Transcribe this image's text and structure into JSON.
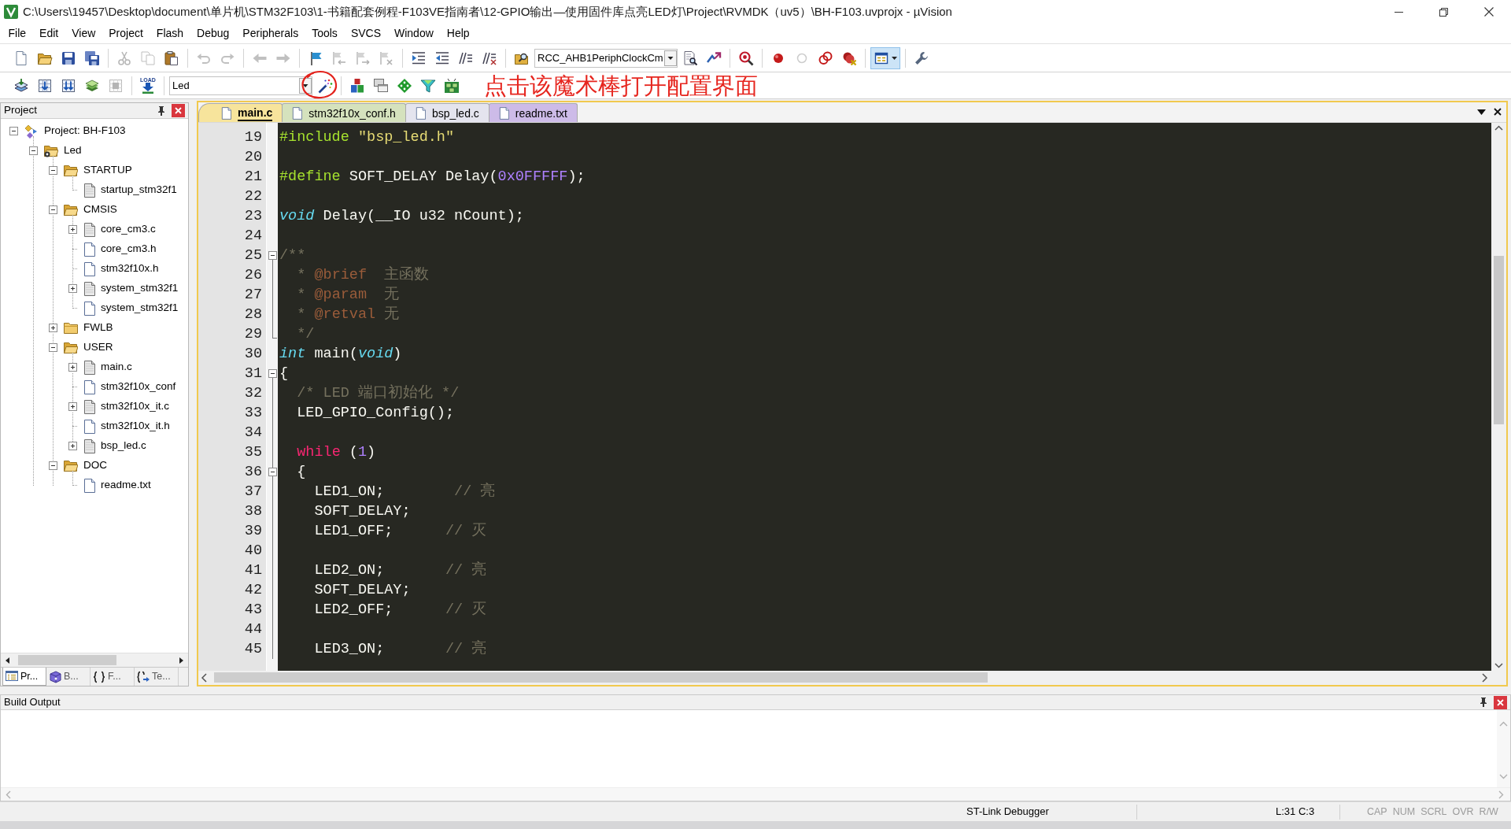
{
  "window": {
    "title": "C:\\Users\\19457\\Desktop\\document\\单片机\\STM32F103\\1-书籍配套例程-F103VE指南者\\12-GPIO输出—使用固件库点亮LED灯\\Project\\RVMDK（uv5）\\BH-F103.uvprojx - µVision",
    "menu": [
      "File",
      "Edit",
      "View",
      "Project",
      "Flash",
      "Debug",
      "Peripherals",
      "Tools",
      "SVCS",
      "Window",
      "Help"
    ]
  },
  "toolbars": [
    {
      "groups": [
        [
          {
            "kind": "new",
            "disabled": false,
            "pressed": false
          },
          {
            "kind": "open",
            "disabled": false,
            "pressed": false
          },
          {
            "kind": "save",
            "disabled": false,
            "pressed": false
          },
          {
            "kind": "save-all",
            "disabled": false,
            "pressed": false
          }
        ],
        [
          {
            "kind": "cut",
            "disabled": true,
            "pressed": false
          },
          {
            "kind": "copy",
            "disabled": true,
            "pressed": false
          },
          {
            "kind": "paste",
            "disabled": false,
            "pressed": false
          }
        ],
        [
          {
            "kind": "undo",
            "disabled": true,
            "pressed": false
          },
          {
            "kind": "redo",
            "disabled": true,
            "pressed": false
          }
        ],
        [
          {
            "kind": "back",
            "disabled": true,
            "pressed": false
          },
          {
            "kind": "forward",
            "disabled": true,
            "pressed": false
          }
        ],
        [
          {
            "kind": "bookmark",
            "disabled": false,
            "pressed": false
          },
          {
            "kind": "bookmark-prev",
            "disabled": true,
            "pressed": false
          },
          {
            "kind": "bookmark-next",
            "disabled": true,
            "pressed": false
          },
          {
            "kind": "bookmark-clear",
            "disabled": true,
            "pressed": false
          }
        ],
        [
          {
            "kind": "indent",
            "disabled": false,
            "pressed": false
          },
          {
            "kind": "outdent",
            "disabled": false,
            "pressed": false
          },
          {
            "kind": "comment",
            "disabled": false,
            "pressed": false
          },
          {
            "kind": "uncomment",
            "disabled": false,
            "pressed": false
          }
        ],
        [
          {
            "kind": "find-in-files",
            "disabled": false,
            "pressed": false
          },
          {
            "kind": "combo",
            "value": "RCC_AHB1PeriphClockCm"
          },
          {
            "kind": "find",
            "disabled": false,
            "pressed": false
          },
          {
            "kind": "incremental-find",
            "disabled": false,
            "pressed": false
          }
        ],
        [
          {
            "kind": "debug",
            "disabled": false,
            "pressed": false
          }
        ],
        [
          {
            "kind": "breakpoint",
            "disabled": false,
            "pressed": false
          },
          {
            "kind": "breakpoint-enable",
            "disabled": true,
            "pressed": false
          },
          {
            "kind": "breakpoint-disable-all",
            "disabled": false,
            "pressed": false
          },
          {
            "kind": "breakpoint-kill-all",
            "disabled": false,
            "pressed": false
          }
        ],
        [
          {
            "kind": "windows",
            "disabled": false,
            "pressed": true
          }
        ],
        [
          {
            "kind": "configure",
            "disabled": false,
            "pressed": false
          }
        ]
      ]
    },
    {
      "groups": [
        [
          {
            "kind": "translate",
            "disabled": false,
            "pressed": false
          },
          {
            "kind": "build",
            "disabled": false,
            "pressed": false
          },
          {
            "kind": "rebuild",
            "disabled": false,
            "pressed": false
          },
          {
            "kind": "batch-build",
            "disabled": false,
            "pressed": false
          },
          {
            "kind": "stop-build",
            "disabled": true,
            "pressed": false
          }
        ],
        [
          {
            "kind": "download",
            "label": "LOAD",
            "disabled": false,
            "pressed": false
          }
        ],
        [
          {
            "kind": "combo",
            "value": "Led"
          },
          {
            "kind": "options",
            "disabled": false,
            "pressed": false
          }
        ],
        [
          {
            "kind": "manage-project",
            "disabled": false,
            "pressed": false
          },
          {
            "kind": "multi-project",
            "disabled": false,
            "pressed": false
          },
          {
            "kind": "run-time-env",
            "disabled": false,
            "pressed": false
          },
          {
            "kind": "pack-select",
            "disabled": false,
            "pressed": false
          },
          {
            "kind": "pack-installer",
            "disabled": false,
            "pressed": false
          }
        ]
      ]
    }
  ],
  "annotation": {
    "text": "点击该魔术棒打开配置界面"
  },
  "project_panel": {
    "title": "Project",
    "tree": [
      {
        "label": "Project: BH-F103",
        "kind": "project",
        "expanded": true,
        "children": [
          {
            "label": "Led",
            "kind": "target",
            "expanded": true,
            "children": [
              {
                "label": "STARTUP",
                "kind": "group",
                "expanded": true,
                "children": [
                  {
                    "label": "startup_stm32f1",
                    "kind": "source"
                  }
                ]
              },
              {
                "label": "CMSIS",
                "kind": "group",
                "expanded": true,
                "children": [
                  {
                    "label": "core_cm3.c",
                    "kind": "source",
                    "expanded": false
                  },
                  {
                    "label": "core_cm3.h",
                    "kind": "document"
                  },
                  {
                    "label": "stm32f10x.h",
                    "kind": "document"
                  },
                  {
                    "label": "system_stm32f1",
                    "kind": "source",
                    "expanded": false
                  },
                  {
                    "label": "system_stm32f1",
                    "kind": "document"
                  }
                ]
              },
              {
                "label": "FWLB",
                "kind": "group",
                "expanded": false
              },
              {
                "label": "USER",
                "kind": "group",
                "expanded": true,
                "children": [
                  {
                    "label": "main.c",
                    "kind": "source",
                    "expanded": false
                  },
                  {
                    "label": "stm32f10x_conf",
                    "kind": "document"
                  },
                  {
                    "label": "stm32f10x_it.c",
                    "kind": "source",
                    "expanded": false
                  },
                  {
                    "label": "stm32f10x_it.h",
                    "kind": "document"
                  },
                  {
                    "label": "bsp_led.c",
                    "kind": "source",
                    "expanded": false
                  }
                ]
              },
              {
                "label": "DOC",
                "kind": "group",
                "expanded": true,
                "children": [
                  {
                    "label": "readme.txt",
                    "kind": "document"
                  }
                ]
              }
            ]
          }
        ]
      }
    ],
    "tabs": [
      {
        "label": "Pr...",
        "kind": "project",
        "selected": true
      },
      {
        "label": "B...",
        "kind": "books",
        "selected": false
      },
      {
        "label": "F...",
        "kind": "functions",
        "selected": false
      },
      {
        "label": "Te...",
        "kind": "templates",
        "selected": false
      }
    ]
  },
  "editor": {
    "tabs": [
      {
        "label": "main.c",
        "selected": true,
        "color": "#f7e49c"
      },
      {
        "label": "stm32f10x_conf.h",
        "selected": false,
        "color": "#d5e2bd"
      },
      {
        "label": "bsp_led.c",
        "selected": false,
        "color": "#e4e4ee"
      },
      {
        "label": "readme.txt",
        "selected": false,
        "color": "#cdbbe8"
      }
    ],
    "lines": [
      {
        "number": "19",
        "kind": "normal",
        "tokens": [
          {
            "kind": "preproc",
            "text": "#include"
          },
          {
            "kind": "string",
            "text": " \"bsp_led.h\""
          }
        ]
      },
      {
        "number": "20",
        "kind": "normal"
      },
      {
        "number": "21",
        "kind": "normal",
        "tokens": [
          {
            "kind": "preproc",
            "text": "#define"
          },
          {
            "kind": "plain",
            "text": " SOFT_DELAY Delay("
          },
          {
            "kind": "number",
            "text": "0x0FFFFF"
          },
          {
            "kind": "plain",
            "text": ");"
          }
        ]
      },
      {
        "number": "22",
        "kind": "normal"
      },
      {
        "number": "23",
        "kind": "normal",
        "tokens": [
          {
            "kind": "type",
            "text": "void"
          },
          {
            "kind": "plain",
            "text": " Delay(__IO u32 nCount);"
          }
        ]
      },
      {
        "number": "24",
        "kind": "normal"
      },
      {
        "number": "25",
        "kind": "fold-start",
        "tokens": [
          {
            "kind": "comment",
            "text": "/**"
          }
        ]
      },
      {
        "number": "26",
        "kind": "fold-body",
        "tokens": [
          {
            "kind": "comment",
            "text": "  * "
          },
          {
            "kind": "doctag",
            "text": "@brief"
          },
          {
            "kind": "comment",
            "text": "  主函数"
          }
        ]
      },
      {
        "number": "27",
        "kind": "fold-body",
        "tokens": [
          {
            "kind": "comment",
            "text": "  * "
          },
          {
            "kind": "doctag",
            "text": "@param"
          },
          {
            "kind": "comment",
            "text": "  无"
          }
        ]
      },
      {
        "number": "28",
        "kind": "fold-body",
        "tokens": [
          {
            "kind": "comment",
            "text": "  * "
          },
          {
            "kind": "doctag",
            "text": "@retval"
          },
          {
            "kind": "comment",
            "text": " 无"
          }
        ]
      },
      {
        "number": "29",
        "kind": "fold-end",
        "tokens": [
          {
            "kind": "comment",
            "text": "  */"
          }
        ]
      },
      {
        "number": "30",
        "kind": "normal",
        "tokens": [
          {
            "kind": "type",
            "text": "int"
          },
          {
            "kind": "plain",
            "text": " main("
          },
          {
            "kind": "type",
            "text": "void"
          },
          {
            "kind": "plain",
            "text": ")"
          }
        ]
      },
      {
        "number": "31",
        "kind": "fold-start",
        "tokens": [
          {
            "kind": "plain",
            "text": "{"
          }
        ]
      },
      {
        "number": "32",
        "kind": "fold-body",
        "tokens": [
          {
            "kind": "comment",
            "text": "  /* LED 端口初始化 */"
          }
        ]
      },
      {
        "number": "33",
        "kind": "fold-body",
        "tokens": [
          {
            "kind": "plain",
            "text": "  LED_GPIO_Config();"
          }
        ]
      },
      {
        "number": "34",
        "kind": "fold-body"
      },
      {
        "number": "35",
        "kind": "fold-body",
        "tokens": [
          {
            "kind": "keyword",
            "text": "  while"
          },
          {
            "kind": "plain",
            "text": " ("
          },
          {
            "kind": "number",
            "text": "1"
          },
          {
            "kind": "plain",
            "text": ")"
          }
        ]
      },
      {
        "number": "36",
        "kind": "fold-start",
        "tokens": [
          {
            "kind": "plain",
            "text": "  {"
          }
        ]
      },
      {
        "number": "37",
        "kind": "fold-body",
        "tokens": [
          {
            "kind": "plain",
            "text": "    LED1_ON;        "
          },
          {
            "kind": "comment",
            "text": "// 亮"
          }
        ]
      },
      {
        "number": "38",
        "kind": "fold-body",
        "tokens": [
          {
            "kind": "plain",
            "text": "    SOFT_DELAY;"
          }
        ]
      },
      {
        "number": "39",
        "kind": "fold-body",
        "tokens": [
          {
            "kind": "plain",
            "text": "    LED1_OFF;      "
          },
          {
            "kind": "comment",
            "text": "// 灭"
          }
        ]
      },
      {
        "number": "40",
        "kind": "fold-body"
      },
      {
        "number": "41",
        "kind": "fold-body",
        "tokens": [
          {
            "kind": "plain",
            "text": "    LED2_ON;       "
          },
          {
            "kind": "comment",
            "text": "// 亮"
          }
        ]
      },
      {
        "number": "42",
        "kind": "fold-body",
        "tokens": [
          {
            "kind": "plain",
            "text": "    SOFT_DELAY;"
          }
        ]
      },
      {
        "number": "43",
        "kind": "fold-body",
        "tokens": [
          {
            "kind": "plain",
            "text": "    LED2_OFF;      "
          },
          {
            "kind": "comment",
            "text": "// 灭"
          }
        ]
      },
      {
        "number": "44",
        "kind": "fold-body"
      },
      {
        "number": "45",
        "kind": "fold-body",
        "tokens": [
          {
            "kind": "plain",
            "text": "    LED3_ON;       "
          },
          {
            "kind": "comment",
            "text": "// 亮"
          }
        ]
      }
    ]
  },
  "build_output": {
    "title": "Build Output"
  },
  "status_bar": {
    "debugger": "ST-Link Debugger",
    "cursor": "L:31 C:3",
    "indicators": [
      {
        "label": "CAP",
        "active": false
      },
      {
        "label": "NUM",
        "active": false
      },
      {
        "label": "SCRL",
        "active": false
      },
      {
        "label": "OVR",
        "active": false
      },
      {
        "label": "R/W",
        "active": false
      }
    ]
  }
}
